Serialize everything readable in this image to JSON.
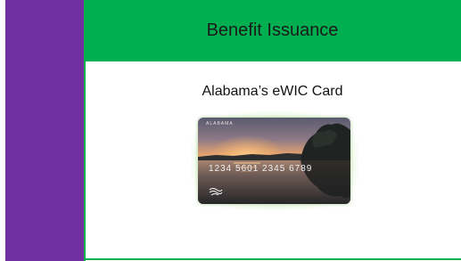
{
  "header": {
    "title": "Benefit Issuance"
  },
  "main": {
    "subtitle": "Alabama’s eWIC Card"
  },
  "card": {
    "brand": "ALABAMA",
    "number": "1234 5601 2345 6789",
    "logo_icon": "wic-logo-icon"
  },
  "colors": {
    "sidebar": "#7030a0",
    "header": "#00b050",
    "accent_line": "#00b050"
  }
}
